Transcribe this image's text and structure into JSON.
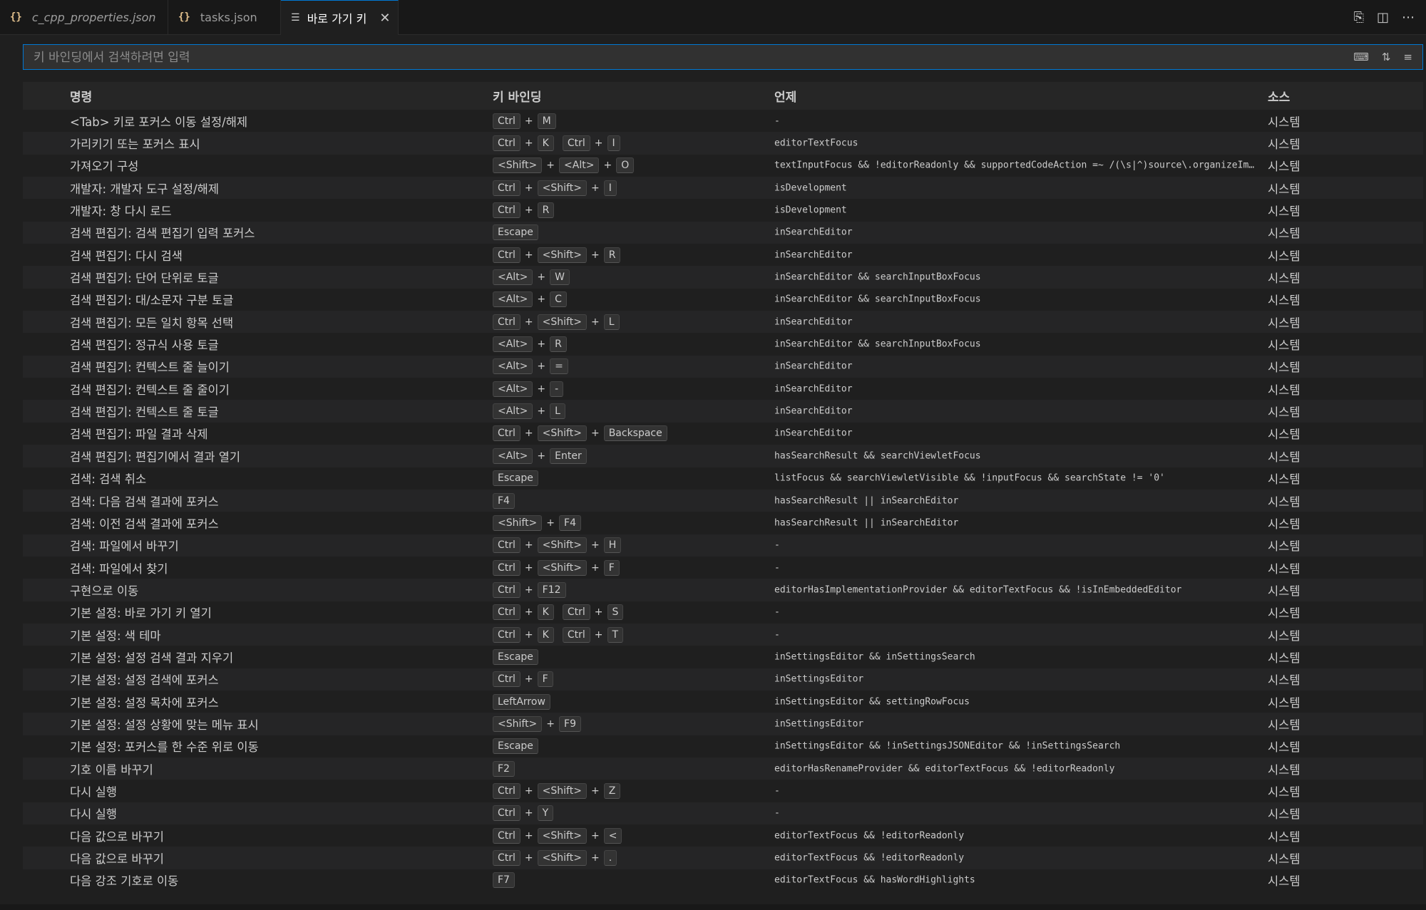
{
  "tabs": [
    {
      "label": "c_cpp_properties.json",
      "icon": "json-braces-icon"
    },
    {
      "label": "tasks.json",
      "icon": "json-braces-icon"
    },
    {
      "label": "바로 가기 키",
      "icon": "keyboard-shortcuts-icon",
      "active": true
    }
  ],
  "search": {
    "placeholder": "키 바인딩에서 검색하려면 입력"
  },
  "columns": {
    "command": "명령",
    "keybinding": "키 바인딩",
    "when": "언제",
    "source": "소스"
  },
  "rows": [
    {
      "command": "<Tab> 키로 포커스 이동 설정/해제",
      "keys": [
        [
          "Ctrl",
          "M"
        ]
      ],
      "when": "-",
      "source": "시스템"
    },
    {
      "command": "가리키기 또는 포커스 표시",
      "keys": [
        [
          "Ctrl",
          "K"
        ],
        [
          "Ctrl",
          "I"
        ]
      ],
      "when": "editorTextFocus",
      "source": "시스템"
    },
    {
      "command": "가져오기 구성",
      "keys": [
        [
          "<Shift>",
          "<Alt>",
          "O"
        ]
      ],
      "when": "textInputFocus && !editorReadonly && supportedCodeAction =~ /(\\s|^)source\\.organizeImpo…",
      "source": "시스템"
    },
    {
      "command": "개발자: 개발자 도구 설정/해제",
      "keys": [
        [
          "Ctrl",
          "<Shift>",
          "I"
        ]
      ],
      "when": "isDevelopment",
      "source": "시스템"
    },
    {
      "command": "개발자: 창 다시 로드",
      "keys": [
        [
          "Ctrl",
          "R"
        ]
      ],
      "when": "isDevelopment",
      "source": "시스템"
    },
    {
      "command": "검색 편집기: 검색 편집기 입력 포커스",
      "keys": [
        [
          "Escape"
        ]
      ],
      "when": "inSearchEditor",
      "source": "시스템"
    },
    {
      "command": "검색 편집기: 다시 검색",
      "keys": [
        [
          "Ctrl",
          "<Shift>",
          "R"
        ]
      ],
      "when": "inSearchEditor",
      "source": "시스템"
    },
    {
      "command": "검색 편집기: 단어 단위로 토글",
      "keys": [
        [
          "<Alt>",
          "W"
        ]
      ],
      "when": "inSearchEditor && searchInputBoxFocus",
      "source": "시스템"
    },
    {
      "command": "검색 편집기: 대/소문자 구분 토글",
      "keys": [
        [
          "<Alt>",
          "C"
        ]
      ],
      "when": "inSearchEditor && searchInputBoxFocus",
      "source": "시스템"
    },
    {
      "command": "검색 편집기: 모든 일치 항목 선택",
      "keys": [
        [
          "Ctrl",
          "<Shift>",
          "L"
        ]
      ],
      "when": "inSearchEditor",
      "source": "시스템"
    },
    {
      "command": "검색 편집기: 정규식 사용 토글",
      "keys": [
        [
          "<Alt>",
          "R"
        ]
      ],
      "when": "inSearchEditor && searchInputBoxFocus",
      "source": "시스템"
    },
    {
      "command": "검색 편집기: 컨텍스트 줄 늘이기",
      "keys": [
        [
          "<Alt>",
          "="
        ]
      ],
      "when": "inSearchEditor",
      "source": "시스템"
    },
    {
      "command": "검색 편집기: 컨텍스트 줄 줄이기",
      "keys": [
        [
          "<Alt>",
          "-"
        ]
      ],
      "when": "inSearchEditor",
      "source": "시스템"
    },
    {
      "command": "검색 편집기: 컨텍스트 줄 토글",
      "keys": [
        [
          "<Alt>",
          "L"
        ]
      ],
      "when": "inSearchEditor",
      "source": "시스템"
    },
    {
      "command": "검색 편집기: 파일 결과 삭제",
      "keys": [
        [
          "Ctrl",
          "<Shift>",
          "Backspace"
        ]
      ],
      "when": "inSearchEditor",
      "source": "시스템"
    },
    {
      "command": "검색 편집기: 편집기에서 결과 열기",
      "keys": [
        [
          "<Alt>",
          "Enter"
        ]
      ],
      "when": "hasSearchResult && searchViewletFocus",
      "source": "시스템"
    },
    {
      "command": "검색: 검색 취소",
      "keys": [
        [
          "Escape"
        ]
      ],
      "when": "listFocus && searchViewletVisible && !inputFocus && searchState != '0'",
      "source": "시스템"
    },
    {
      "command": "검색: 다음 검색 결과에 포커스",
      "keys": [
        [
          "F4"
        ]
      ],
      "when": "hasSearchResult || inSearchEditor",
      "source": "시스템"
    },
    {
      "command": "검색: 이전 검색 결과에 포커스",
      "keys": [
        [
          "<Shift>",
          "F4"
        ]
      ],
      "when": "hasSearchResult || inSearchEditor",
      "source": "시스템"
    },
    {
      "command": "검색: 파일에서 바꾸기",
      "keys": [
        [
          "Ctrl",
          "<Shift>",
          "H"
        ]
      ],
      "when": "-",
      "source": "시스템"
    },
    {
      "command": "검색: 파일에서 찾기",
      "keys": [
        [
          "Ctrl",
          "<Shift>",
          "F"
        ]
      ],
      "when": "-",
      "source": "시스템"
    },
    {
      "command": "구현으로 이동",
      "keys": [
        [
          "Ctrl",
          "F12"
        ]
      ],
      "when": "editorHasImplementationProvider && editorTextFocus && !isInEmbeddedEditor",
      "source": "시스템"
    },
    {
      "command": "기본 설정: 바로 가기 키 열기",
      "keys": [
        [
          "Ctrl",
          "K"
        ],
        [
          "Ctrl",
          "S"
        ]
      ],
      "when": "-",
      "source": "시스템"
    },
    {
      "command": "기본 설정: 색 테마",
      "keys": [
        [
          "Ctrl",
          "K"
        ],
        [
          "Ctrl",
          "T"
        ]
      ],
      "when": "-",
      "source": "시스템"
    },
    {
      "command": "기본 설정: 설정 검색 결과 지우기",
      "keys": [
        [
          "Escape"
        ]
      ],
      "when": "inSettingsEditor && inSettingsSearch",
      "source": "시스템"
    },
    {
      "command": "기본 설정: 설정 검색에 포커스",
      "keys": [
        [
          "Ctrl",
          "F"
        ]
      ],
      "when": "inSettingsEditor",
      "source": "시스템"
    },
    {
      "command": "기본 설정: 설정 목차에 포커스",
      "keys": [
        [
          "LeftArrow"
        ]
      ],
      "when": "inSettingsEditor && settingRowFocus",
      "source": "시스템"
    },
    {
      "command": "기본 설정: 설정 상황에 맞는 메뉴 표시",
      "keys": [
        [
          "<Shift>",
          "F9"
        ]
      ],
      "when": "inSettingsEditor",
      "source": "시스템"
    },
    {
      "command": "기본 설정: 포커스를 한 수준 위로 이동",
      "keys": [
        [
          "Escape"
        ]
      ],
      "when": "inSettingsEditor && !inSettingsJSONEditor && !inSettingsSearch",
      "source": "시스템"
    },
    {
      "command": "기호 이름 바꾸기",
      "keys": [
        [
          "F2"
        ]
      ],
      "when": "editorHasRenameProvider && editorTextFocus && !editorReadonly",
      "source": "시스템"
    },
    {
      "command": "다시 실행",
      "keys": [
        [
          "Ctrl",
          "<Shift>",
          "Z"
        ]
      ],
      "when": "-",
      "source": "시스템"
    },
    {
      "command": "다시 실행",
      "keys": [
        [
          "Ctrl",
          "Y"
        ]
      ],
      "when": "-",
      "source": "시스템"
    },
    {
      "command": "다음 값으로 바꾸기",
      "keys": [
        [
          "Ctrl",
          "<Shift>",
          "<"
        ]
      ],
      "when": "editorTextFocus && !editorReadonly",
      "source": "시스템"
    },
    {
      "command": "다음 값으로 바꾸기",
      "keys": [
        [
          "Ctrl",
          "<Shift>",
          "."
        ]
      ],
      "when": "editorTextFocus && !editorReadonly",
      "source": "시스템"
    },
    {
      "command": "다음 강조 기호로 이동",
      "keys": [
        [
          "F7"
        ]
      ],
      "when": "editorTextFocus && hasWordHighlights",
      "source": "시스템"
    }
  ]
}
